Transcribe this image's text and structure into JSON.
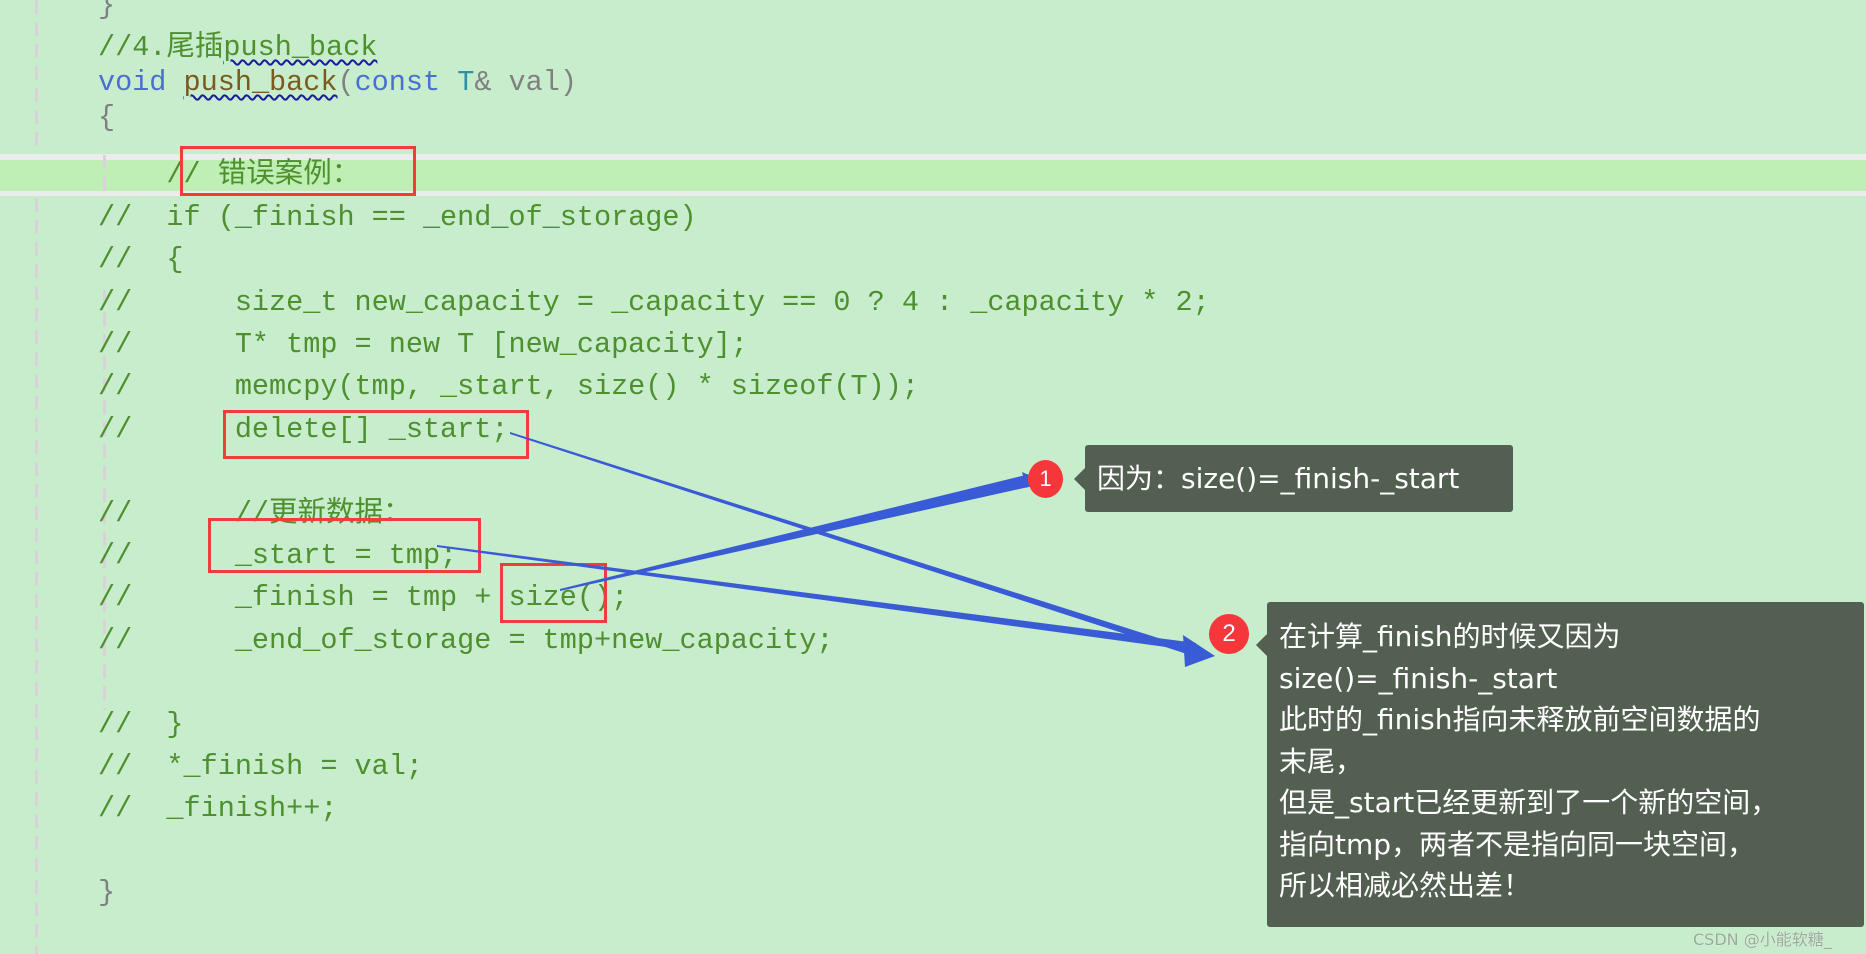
{
  "editor": {
    "colors": {
      "background": "#c7edcc",
      "current_line": "#bfefb4",
      "comment": "#4e8f2e",
      "keyword": "#4a6fd0",
      "function": "#7a5a1e",
      "type": "#2b91af",
      "annotation_red": "#f23b3b",
      "arrow_blue": "#3a5bd6",
      "callout_bg": "#525f51",
      "badge_red": "#f5363a"
    },
    "lines": {
      "l0": "}",
      "l1_prefix": "//4.尾插",
      "l1_squiggle": "push_back",
      "l2_void": "void",
      "l2_fn": "push_back",
      "l2_open": "(",
      "l2_const": "const",
      "l2_type": "T",
      "l2_rest": "& val)",
      "l3": "{",
      "l4": "    // 错误案例：",
      "l5": "//  if (_finish == _end_of_storage)",
      "l6": "//  {",
      "l7": "//      size_t new_capacity = _capacity == 0 ? 4 : _capacity * 2;",
      "l8": "//      T* tmp = new T [new_capacity];",
      "l9": "//      memcpy(tmp, _start, size() * sizeof(T));",
      "l10": "//      delete[] _start;",
      "l11": "//      //更新数据：",
      "l12": "//      _start = tmp;",
      "l13": "//      _finish = tmp + size();",
      "l14": "//      _end_of_storage = tmp+new_capacity;",
      "l15": "//  }",
      "l16": "//  *_finish = val;",
      "l17": "//  _finish++;",
      "l18": "}"
    }
  },
  "annotations": {
    "badge1": "1",
    "badge2": "2",
    "callout1": "因为：size()=_finish-_start",
    "callout2": [
      "在计算_finish的时候又因为",
      "size()=_finish-_start",
      "此时的_finish指向未释放前空间数据的",
      "末尾，",
      "但是_start已经更新到了一个新的空间，",
      "指向tmp，两者不是指向同一块空间，",
      "所以相减必然出差！"
    ]
  },
  "watermark": "CSDN @小能软糖_"
}
